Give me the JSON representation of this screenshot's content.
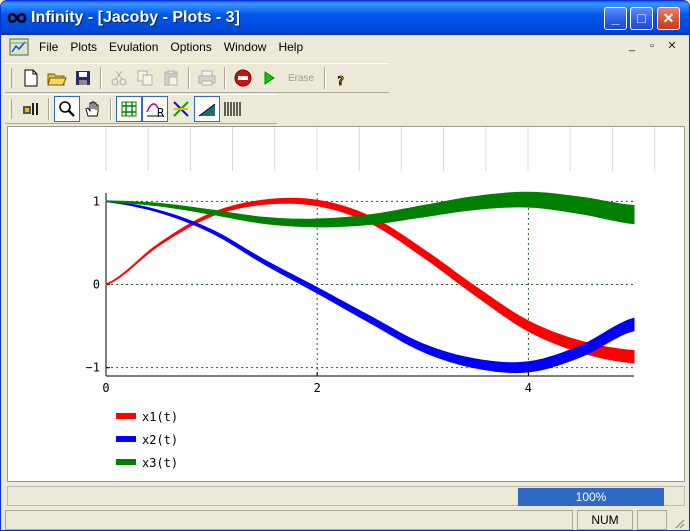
{
  "window": {
    "title": "Infinity - [Jacoby - Plots - 3]",
    "minimize": "_",
    "maximize": "□",
    "close": "✕"
  },
  "menu": {
    "items": [
      "File",
      "Plots",
      "Evulation",
      "Options",
      "Window",
      "Help"
    ],
    "mdi": [
      "_",
      "▫",
      "✕"
    ]
  },
  "toolbar": {
    "erase_label": "Erase"
  },
  "chart_data": {
    "type": "line",
    "x_ticks": [
      "0",
      "2",
      "4"
    ],
    "y_ticks": [
      "1",
      "0",
      "−1"
    ],
    "xlim": [
      0,
      5
    ],
    "ylim": [
      -1.1,
      1.1
    ],
    "grid": true,
    "legend_position": "bottom-left",
    "series": [
      {
        "name": "x1(t)",
        "color": "#ff0000",
        "x": [
          0,
          0.5,
          1,
          1.5,
          2,
          2.5,
          3,
          3.5,
          4,
          4.5,
          5
        ],
        "y": [
          0,
          0.48,
          0.84,
          0.99,
          0.98,
          0.78,
          0.38,
          -0.08,
          -0.5,
          -0.75,
          -0.87
        ],
        "width_start": 0.01,
        "width_end": 0.15
      },
      {
        "name": "x2(t)",
        "color": "#0000ff",
        "x": [
          0,
          0.5,
          1,
          1.5,
          2,
          2.5,
          3,
          3.5,
          4,
          4.5,
          5
        ],
        "y": [
          1,
          0.88,
          0.64,
          0.27,
          -0.07,
          -0.42,
          -0.76,
          -0.95,
          -0.99,
          -0.8,
          -0.48
        ],
        "width_start": 0.01,
        "width_end": 0.15
      },
      {
        "name": "x3(t)",
        "color": "#008000",
        "x": [
          0,
          0.5,
          1,
          1.5,
          2,
          2.5,
          3,
          3.5,
          4,
          4.5,
          5
        ],
        "y": [
          1,
          0.96,
          0.87,
          0.77,
          0.74,
          0.78,
          0.88,
          0.98,
          1.02,
          0.95,
          0.84
        ],
        "width_start": 0.01,
        "width_end": 0.22
      }
    ]
  },
  "status": {
    "progress_label": "100%",
    "num": "NUM"
  }
}
